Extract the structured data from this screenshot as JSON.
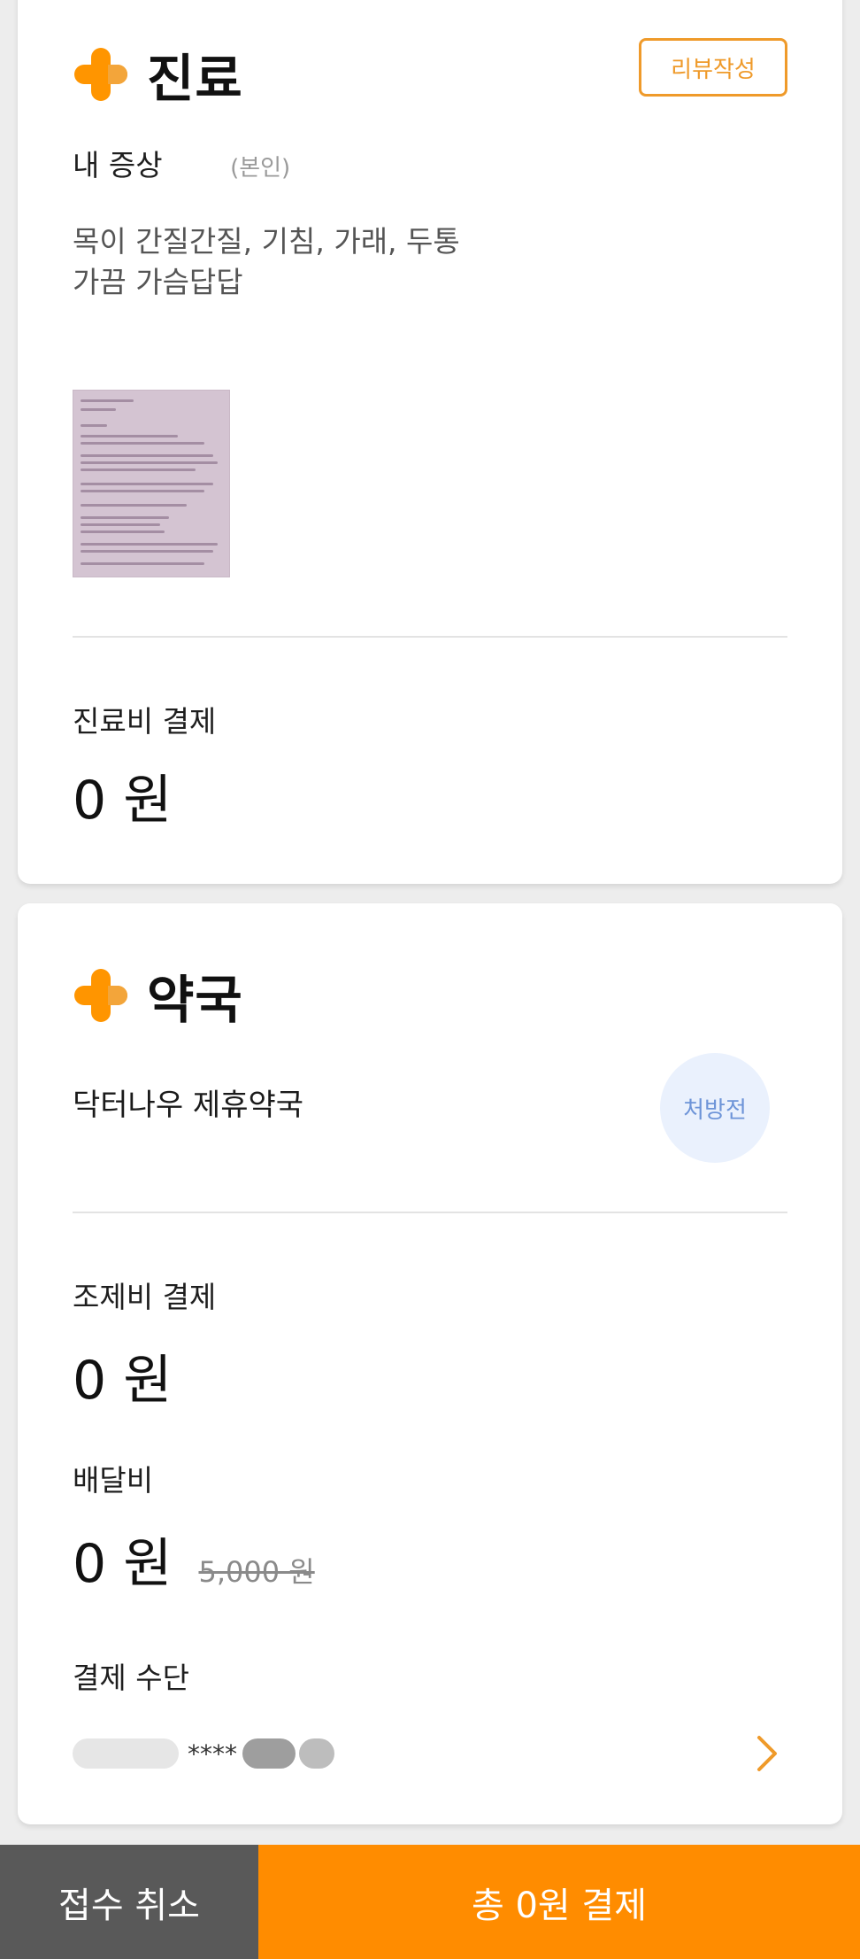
{
  "clinic_section": {
    "title": "진료",
    "review_button": "리뷰작성",
    "symptoms_label": "내 증상",
    "patient_relation": "(본인)",
    "symptoms_line1": "목이 간질간질, 기침, 가래, 두통",
    "symptoms_line2": "가끔 가슴답답",
    "fee_label": "진료비 결제",
    "fee_amount": "0 원"
  },
  "pharmacy_section": {
    "title": "약국",
    "pharmacy_name": "닥터나우 제휴약국",
    "prescription_status": "처방전",
    "prep_fee_label": "조제비 결제",
    "prep_fee_amount": "0 원",
    "delivery_label": "배달비",
    "delivery_amount": "0 원",
    "delivery_original": "5,000 원",
    "payment_method_label": "결제 수단",
    "card_masked": "****"
  },
  "bottom_bar": {
    "cancel_label": "접수 취소",
    "pay_label": "총 0원 결제"
  },
  "colors": {
    "accent": "#ff8c00",
    "cancel": "#595959",
    "badge_bg": "#eaf1fd",
    "badge_text": "#6d94d8"
  }
}
